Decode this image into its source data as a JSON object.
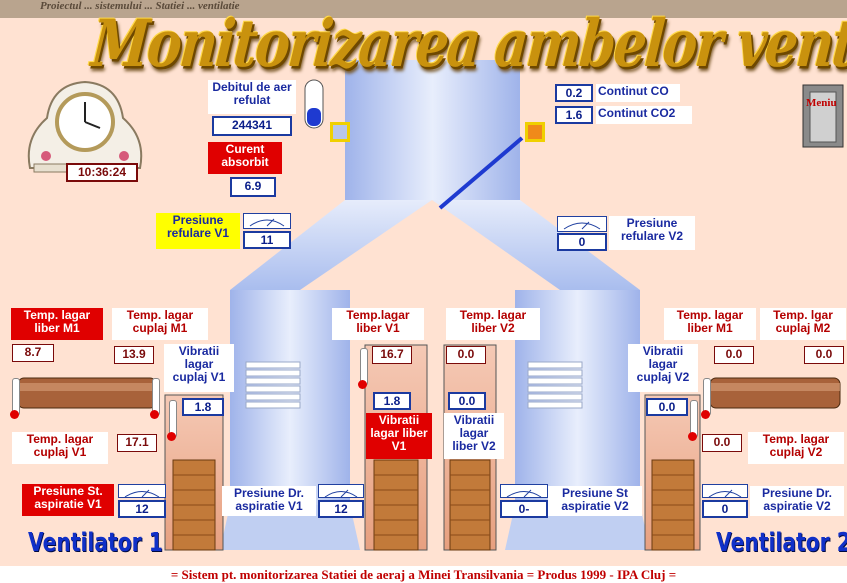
{
  "header": {
    "title": "Monitorizarea ambelor ventilatoare",
    "top_strip": "Proiectul ... sistemului ... Statiei ... ventilatie"
  },
  "clock": {
    "time": "10:36:24"
  },
  "flow": {
    "label": "Debitul de aer refulat",
    "value": "244341"
  },
  "current": {
    "label": "Curent absorbit",
    "value": "6.9"
  },
  "gas": {
    "co_value": "0.2",
    "co_label": "Continut CO",
    "co2_value": "1.6",
    "co2_label": "Continut CO2"
  },
  "menu": {
    "label": "Meniu"
  },
  "pressure": {
    "ref_v1_label": "Presiune refulare V1",
    "ref_v1_value": "11",
    "ref_v2_label": "Presiune refulare V2",
    "ref_v2_value": "0",
    "asp_st_v1_label": "Presiune St. aspiratie V1",
    "asp_st_v1_value": "12",
    "asp_dr_v1_label": "Presiune Dr. aspiratie V1",
    "asp_dr_v1_value": "12",
    "asp_st_v2_label": "Presiune St aspiratie V2",
    "asp_st_v2_value": "0-",
    "asp_dr_v2_label": "Presiune Dr. aspiratie V2",
    "asp_dr_v2_value": "0"
  },
  "v1": {
    "name": "Ventilator 1",
    "temp_lagar_liber_m1_label": "Temp. lagar liber M1",
    "temp_lagar_liber_m1_value": "8.7",
    "temp_lagar_cuplaj_m1_label": "Temp. lagar cuplaj M1",
    "temp_lagar_cuplaj_m1_value": "13.9",
    "temp_lagar_cuplaj_v1_label": "Temp. lagar cuplaj V1",
    "temp_lagar_cuplaj_v1_value": "17.1",
    "vib_cuplaj_v1_label": "Vibratii lagar cuplaj V1",
    "vib_cuplaj_v1_value": "1.8",
    "temp_lagar_liber_v1_label": "Temp.lagar liber V1",
    "temp_lagar_liber_v1_value": "16.7",
    "vib_liber_v1_label": "Vibratii lagar liber V1",
    "vib_liber_v1_value": "1.8"
  },
  "v2": {
    "name": "Ventilator 2",
    "temp_lagar_liber_v2_label": "Temp. lagar liber V2",
    "temp_lagar_liber_v2_value": "0.0",
    "vib_liber_v2_label": "Vibratii lagar liber V2",
    "vib_liber_v2_value": "0.0",
    "vib_cuplaj_v2_label": "Vibratii lagar cuplaj V2",
    "vib_cuplaj_v2_value": "0.0",
    "temp_lagar_liber_m1_label": "Temp. lagar liber M1",
    "temp_lagar_liber_m1_value": "0.0",
    "temp_lgar_cuplaj_m2_label": "Temp. lgar cuplaj M2",
    "temp_lgar_cuplaj_m2_value": "0.0",
    "temp_lagar_cuplaj_v2_label": "Temp. lagar cuplaj V2",
    "temp_lagar_cuplaj_v2_value": "0.0"
  },
  "footer": {
    "text": "= Sistem pt. monitorizarea Statiei de aeraj a Minei Transilvania = Produs 1999 - IPA Cluj ="
  },
  "colors": {
    "background": "#ffe2d2",
    "duct": "#b4c6f0",
    "label_red": "#e00000",
    "label_blue": "#1a2aa0",
    "banner_gold": "#c9920e"
  }
}
